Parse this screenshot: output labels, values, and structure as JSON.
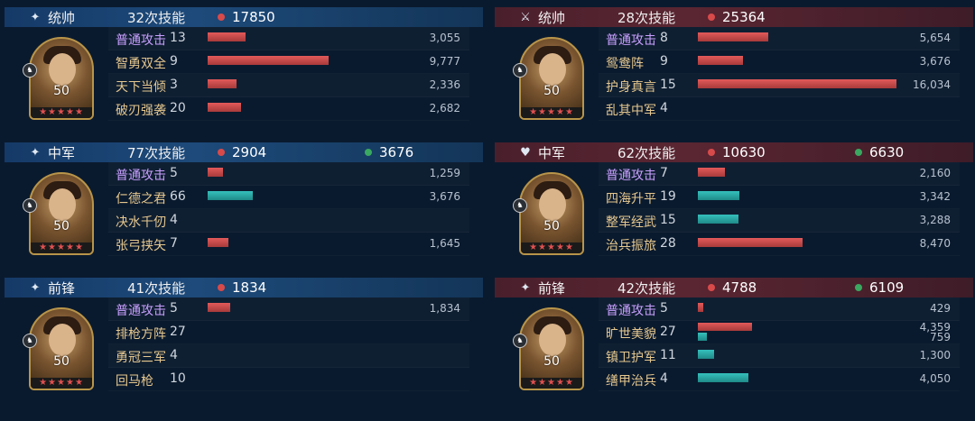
{
  "colors": {
    "damage": "#c94a4a",
    "heal": "#2aa7a4",
    "red_dot": "#d84a4a",
    "green_dot": "#3aa860"
  },
  "left": [
    {
      "role": "统帅",
      "skills": "32次技能",
      "damage": "17850",
      "heal": "",
      "level": "50",
      "rows": [
        {
          "name": "普通攻击",
          "count": "13",
          "basic": true,
          "bars": [
            {
              "kind": "damage",
              "value": 3055,
              "label": "3,055"
            }
          ]
        },
        {
          "name": "智勇双全",
          "count": "9",
          "bars": [
            {
              "kind": "damage",
              "value": 9777,
              "label": "9,777"
            }
          ]
        },
        {
          "name": "天下当倾",
          "count": "3",
          "bars": [
            {
              "kind": "damage",
              "value": 2336,
              "label": "2,336"
            }
          ]
        },
        {
          "name": "破刃强袭",
          "count": "20",
          "bars": [
            {
              "kind": "damage",
              "value": 2682,
              "label": "2,682"
            }
          ]
        }
      ]
    },
    {
      "role": "中军",
      "skills": "77次技能",
      "damage": "2904",
      "heal": "3676",
      "level": "50",
      "rows": [
        {
          "name": "普通攻击",
          "count": "5",
          "basic": true,
          "bars": [
            {
              "kind": "damage",
              "value": 1259,
              "label": "1,259"
            }
          ]
        },
        {
          "name": "仁德之君",
          "count": "66",
          "bars": [
            {
              "kind": "heal",
              "value": 3676,
              "label": "3,676"
            }
          ]
        },
        {
          "name": "决水千仞",
          "count": "4",
          "bars": []
        },
        {
          "name": "张弓挟矢",
          "count": "7",
          "bars": [
            {
              "kind": "damage",
              "value": 1645,
              "label": "1,645"
            }
          ]
        }
      ]
    },
    {
      "role": "前锋",
      "skills": "41次技能",
      "damage": "1834",
      "heal": "",
      "level": "50",
      "rows": [
        {
          "name": "普通攻击",
          "count": "5",
          "basic": true,
          "bars": [
            {
              "kind": "damage",
              "value": 1834,
              "label": "1,834"
            }
          ]
        },
        {
          "name": "排枪方阵",
          "count": "27",
          "bars": []
        },
        {
          "name": "勇冠三军",
          "count": "4",
          "bars": []
        },
        {
          "name": "回马枪",
          "count": "10",
          "bars": []
        }
      ]
    }
  ],
  "right": [
    {
      "role": "统帅",
      "skills": "28次技能",
      "damage": "25364",
      "heal": "",
      "level": "50",
      "rows": [
        {
          "name": "普通攻击",
          "count": "8",
          "basic": true,
          "bars": [
            {
              "kind": "damage",
              "value": 5654,
              "label": "5,654"
            }
          ]
        },
        {
          "name": "鸳鸯阵",
          "count": "9",
          "bars": [
            {
              "kind": "damage",
              "value": 3676,
              "label": "3,676"
            }
          ]
        },
        {
          "name": "护身真言",
          "count": "15",
          "bars": [
            {
              "kind": "damage",
              "value": 16034,
              "label": "16,034"
            }
          ]
        },
        {
          "name": "乱其中军",
          "count": "4",
          "bars": []
        }
      ]
    },
    {
      "role": "中军",
      "skills": "62次技能",
      "damage": "10630",
      "heal": "6630",
      "level": "50",
      "rows": [
        {
          "name": "普通攻击",
          "count": "7",
          "basic": true,
          "bars": [
            {
              "kind": "damage",
              "value": 2160,
              "label": "2,160"
            }
          ]
        },
        {
          "name": "四海升平",
          "count": "19",
          "bars": [
            {
              "kind": "heal",
              "value": 3342,
              "label": "3,342"
            }
          ]
        },
        {
          "name": "整军经武",
          "count": "15",
          "bars": [
            {
              "kind": "heal",
              "value": 3288,
              "label": "3,288"
            }
          ]
        },
        {
          "name": "治兵振旅",
          "count": "28",
          "bars": [
            {
              "kind": "damage",
              "value": 8470,
              "label": "8,470"
            }
          ]
        }
      ]
    },
    {
      "role": "前锋",
      "skills": "42次技能",
      "damage": "4788",
      "heal": "6109",
      "level": "50",
      "rows": [
        {
          "name": "普通攻击",
          "count": "5",
          "basic": true,
          "bars": [
            {
              "kind": "damage",
              "value": 429,
              "label": "429"
            }
          ]
        },
        {
          "name": "旷世美貌",
          "count": "27",
          "bars": [
            {
              "kind": "damage",
              "value": 4359,
              "label": "4,359"
            },
            {
              "kind": "heal",
              "value": 759,
              "label": "759"
            }
          ]
        },
        {
          "name": "镇卫护军",
          "count": "11",
          "bars": [
            {
              "kind": "heal",
              "value": 1300,
              "label": "1,300"
            }
          ]
        },
        {
          "name": "缮甲治兵",
          "count": "4",
          "bars": [
            {
              "kind": "heal",
              "value": 4050,
              "label": "4,050"
            }
          ]
        }
      ]
    }
  ]
}
